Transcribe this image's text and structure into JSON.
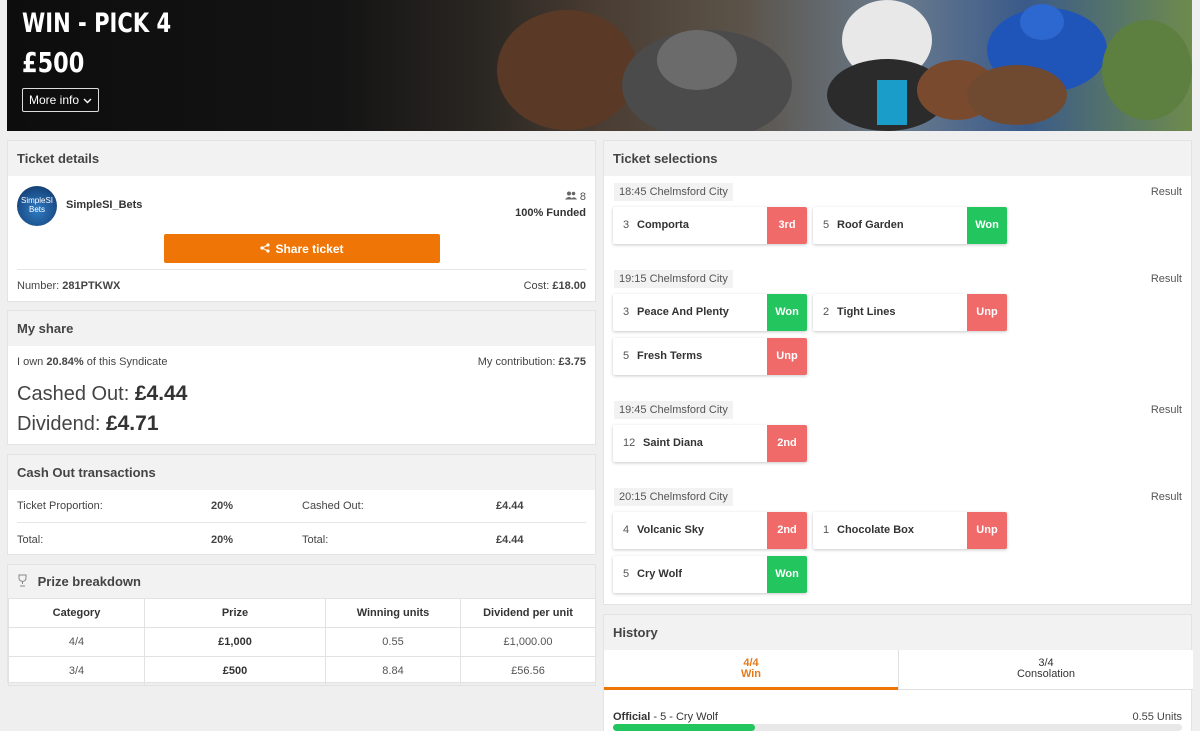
{
  "header": {
    "title": "WIN - PICK 4",
    "amount": "£500",
    "more_info": "More info"
  },
  "ticket_details": {
    "title": "Ticket details",
    "avatar_text": "SimpleSI Bets",
    "user": "SimpleSI_Bets",
    "members": "8",
    "funded": "100% Funded",
    "share_button": "Share ticket",
    "number_label": "Number:",
    "number": "281PTKWX",
    "cost_label": "Cost:",
    "cost": "£18.00"
  },
  "my_share": {
    "title": "My share",
    "own_prefix": "I own",
    "own_pct": "20.84%",
    "own_suffix": "of this Syndicate",
    "contribution_label": "My contribution:",
    "contribution": "£3.75",
    "cashed_out_label": "Cashed Out:",
    "cashed_out": "£4.44",
    "dividend_label": "Dividend:",
    "dividend": "£4.71"
  },
  "cash_out": {
    "title": "Cash Out transactions",
    "rows": [
      {
        "label": "Ticket Proportion:",
        "pct": "20%",
        "label2": "Cashed Out:",
        "value": "£4.44"
      },
      {
        "label": "Total:",
        "pct": "20%",
        "label2": "Total:",
        "value": "£4.44"
      }
    ]
  },
  "prize": {
    "title": "Prize breakdown",
    "headers": [
      "Category",
      "Prize",
      "Winning units",
      "Dividend per unit"
    ],
    "rows": [
      [
        "4/4",
        "£1,000",
        "0.55",
        "£1,000.00"
      ],
      [
        "3/4",
        "£500",
        "8.84",
        "£56.56"
      ]
    ]
  },
  "selections": {
    "title": "Ticket selections",
    "result_label": "Result",
    "races": [
      {
        "time": "18:45 Chelmsford City",
        "picks": [
          {
            "num": "3",
            "name": "Comporta",
            "result": "3rd",
            "status": "red"
          },
          {
            "num": "5",
            "name": "Roof Garden",
            "result": "Won",
            "status": "green"
          }
        ]
      },
      {
        "time": "19:15 Chelmsford City",
        "picks": [
          {
            "num": "3",
            "name": "Peace And Plenty",
            "result": "Won",
            "status": "green"
          },
          {
            "num": "2",
            "name": "Tight Lines",
            "result": "Unp",
            "status": "red"
          },
          {
            "num": "5",
            "name": "Fresh Terms",
            "result": "Unp",
            "status": "red"
          }
        ]
      },
      {
        "time": "19:45 Chelmsford City",
        "picks": [
          {
            "num": "12",
            "name": "Saint Diana",
            "result": "2nd",
            "status": "red"
          }
        ]
      },
      {
        "time": "20:15 Chelmsford City",
        "picks": [
          {
            "num": "4",
            "name": "Volcanic Sky",
            "result": "2nd",
            "status": "red"
          },
          {
            "num": "1",
            "name": "Chocolate Box",
            "result": "Unp",
            "status": "red"
          },
          {
            "num": "5",
            "name": "Cry Wolf",
            "result": "Won",
            "status": "green"
          }
        ]
      }
    ]
  },
  "history": {
    "title": "History",
    "tabs": [
      {
        "top": "4/4",
        "bottom": "Win"
      },
      {
        "top": "3/4",
        "bottom": "Consolation"
      }
    ],
    "official_label": "Official",
    "official_detail": "- 5 - Cry Wolf",
    "units": "0.55 Units",
    "progress": 0.25
  },
  "colors": {
    "accent": "#ee7506",
    "won": "#22c55e",
    "lost": "#f06a6a"
  }
}
